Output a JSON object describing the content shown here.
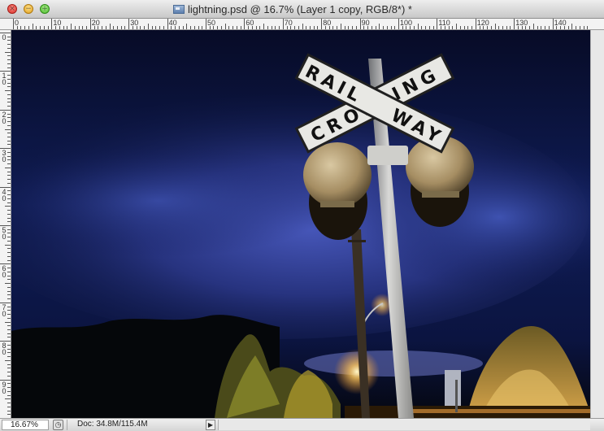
{
  "window": {
    "title": "lightning.psd @ 16.7% (Layer 1 copy, RGB/8*) *",
    "controls": {
      "close_icon": "close-icon",
      "minimize_icon": "minimize-icon",
      "zoom_icon": "zoom-icon"
    }
  },
  "rulers": {
    "top_labels": [
      "0",
      "10",
      "20",
      "30",
      "40",
      "50",
      "60",
      "70",
      "80",
      "90",
      "100",
      "110",
      "120",
      "130",
      "140"
    ],
    "left_labels": [
      "0",
      "1 0",
      "2 0",
      "3 0",
      "4 0",
      "5 0",
      "6 0",
      "7 0",
      "8 0",
      "9 0"
    ]
  },
  "canvas": {
    "sign_text_top": "RAILWAY",
    "sign_text_bottom": "CROSSING"
  },
  "status": {
    "zoom": "16.67%",
    "doc_info": "Doc: 34.8M/115.4M"
  },
  "colors": {
    "sky": "#0b1a4a",
    "storm_cloud": "#3a49a8",
    "tree_glow": "#c9a43a",
    "lamp": "#fff2b0"
  }
}
